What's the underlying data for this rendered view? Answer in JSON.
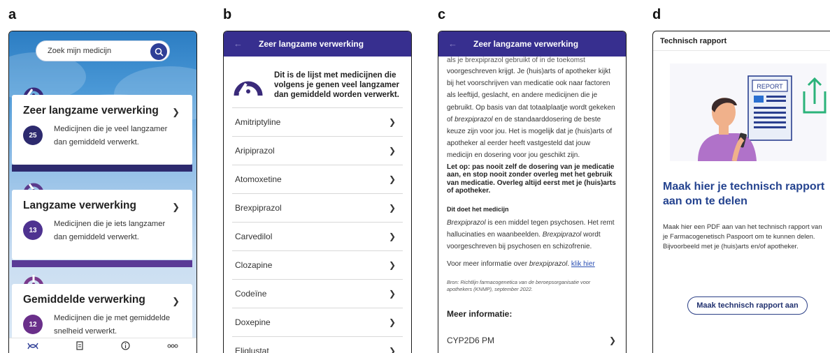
{
  "panel_letters": [
    "a",
    "b",
    "c",
    "d"
  ],
  "colors": {
    "brand_purple": "#372f8f",
    "badge_purple": "#3a2a7a",
    "accent_green": "#2bb37a",
    "link_blue": "#2a4fb3",
    "title_blue": "#24438f"
  },
  "panel_a": {
    "search_placeholder": "Zoek mijn medicijn",
    "cards": [
      {
        "title": "Zeer langzame verwerking",
        "count": "25",
        "desc": "Medicijnen die je veel langzamer dan gemiddeld verwerkt."
      },
      {
        "title": "Langzame verwerking",
        "count": "13",
        "desc": "Medicijnen die je iets langzamer dan gemiddeld verwerkt."
      },
      {
        "title": "Gemiddelde verwerking",
        "count": "12",
        "desc": "Medicijnen die je met gemiddelde snelheid verwerkt."
      }
    ],
    "nav_icons": [
      "dna-icon",
      "document-icon",
      "info-icon",
      "more-icon"
    ]
  },
  "panel_b": {
    "header_title": "Zeer langzame verwerking",
    "intro": "Dit is de lijst met medicijnen die volgens je genen veel langzamer dan gemiddeld worden verwerkt.",
    "items": [
      "Amitriptyline",
      "Aripiprazol",
      "Atomoxetine",
      "Brexpiprazol",
      "Carvedilol",
      "Clozapine",
      "Codeïne",
      "Doxepine",
      "Eliglustat"
    ]
  },
  "panel_c": {
    "header_title": "Zeer langzame verwerking",
    "para1_top": "als je brexpiprazol gebruikt of in de toekomst",
    "para1": "voorgeschreven krijgt. Je (huis)arts of apotheker kijkt bij het voorschrijven van medicatie ook naar factoren als leeftijd, geslacht, en andere medicijnen die je gebruikt. Op basis van dat totaalplaatje wordt gekeken of",
    "para1_drug": "brexpiprazol",
    "para1_end": "en de standaarddosering de beste keuze zijn voor jou. Het is mogelijk dat je (huis)arts of apotheker al eerder heeft vastgesteld dat jouw medicijn en dosering voor jou geschikt zijn.",
    "warning": "Let op: pas nooit zelf de dosering van je medicatie aan, en stop nooit zonder overleg met het gebruik van medicatie. Overleg altijd eerst met je (huis)arts of apotheker.",
    "section_title": "Dit doet het medicijn",
    "drug": "Brexpiprazol",
    "section_text_1": "is een middel tegen psychosen. Het remt hallucinaties en waanbeelden.",
    "drug_2": "Brexpiprazol",
    "section_text_2": "wordt voorgeschreven bij psychosen en schizofrenie.",
    "more_info_prefix": "Voor meer informatie over",
    "more_info_drug": "brexpiprazol",
    "more_info_link": "klik hier",
    "source": "Bron: Richtlijn farmacogenetica van de beroepsorganisatie voor apothekers (KNMP), september 2022.",
    "meer_title": "Meer informatie:",
    "meer_row": "CYP2D6 PM"
  },
  "panel_d": {
    "header_title": "Technisch rapport",
    "report_label": "REPORT",
    "title": "Maak hier je technisch rapport aan om te delen",
    "text": "Maak hier een PDF aan van het technisch rapport van je Farmacogenetisch Paspoort om te kunnen delen. Bijvoorbeeld met je (huis)arts en/of apotheker.",
    "button": "Maak technisch rapport aan"
  }
}
